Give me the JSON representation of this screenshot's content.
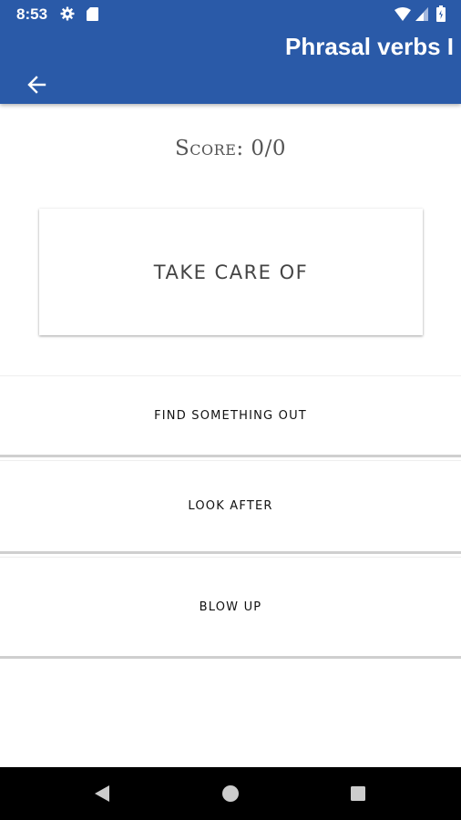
{
  "status_bar": {
    "time": "8:53",
    "icons": [
      "gear-icon",
      "sd-card-icon",
      "wifi-icon",
      "signal-icon",
      "battery-icon"
    ]
  },
  "app_bar": {
    "title": "Phrasal verbs I",
    "back_icon": "arrow-left-icon",
    "color": "#2a5aa8"
  },
  "quiz": {
    "score_label": "Score: 0/0",
    "question": "TAKE CARE OF",
    "answers": [
      {
        "label": "FIND SOMETHING OUT"
      },
      {
        "label": "LOOK AFTER"
      },
      {
        "label": "BLOW UP"
      }
    ]
  },
  "nav_bar": {
    "buttons": [
      "back-triangle-icon",
      "home-circle-icon",
      "recents-square-icon"
    ]
  }
}
